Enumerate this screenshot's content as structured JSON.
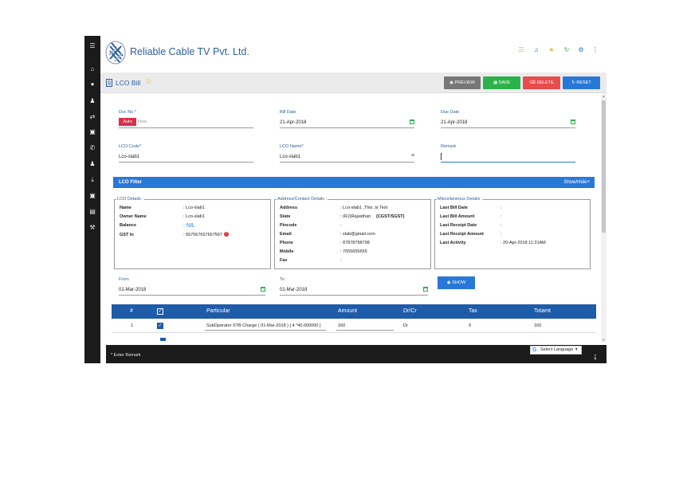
{
  "company": {
    "name": "Reliable Cable TV Pvt. Ltd."
  },
  "colors": {
    "primary": "#2878d8",
    "accent_text": "#2d5f9e",
    "save": "#2bb34a",
    "delete": "#e84c4c",
    "preview": "#777777",
    "sidebar": "#1b1b1b",
    "table_header": "#1e5ba8"
  },
  "sidebar": {
    "icons": [
      "menu-icon",
      "home-icon",
      "globe-icon",
      "user-icon",
      "transfer-icon",
      "book-icon",
      "phone-icon",
      "users-icon",
      "download-icon",
      "box-icon",
      "report-icon",
      "wrench-icon"
    ]
  },
  "header": {
    "icons": [
      "list-icon",
      "bell-icon",
      "star-icon",
      "refresh-icon",
      "gear-icon",
      "more-vertical-icon"
    ]
  },
  "page": {
    "title": "LCO Bill"
  },
  "toolbar": {
    "preview_label": "PREVIEW",
    "save_label": "SAVE",
    "delete_label": "DELETE",
    "reset_label": "RESET"
  },
  "form": {
    "doc_no": {
      "label": "Doc No.*",
      "badge": "Auto",
      "placeholder": "New"
    },
    "bill_date": {
      "label": "Bill Date",
      "value": "21-Apr-2018"
    },
    "due_date": {
      "label": "Due Date",
      "value": "21-Apr-2018"
    },
    "lco_code": {
      "label": "LCO Code*",
      "value": "Lco-slab1"
    },
    "lco_name": {
      "label": "LCO Name*",
      "value": "Lco-slab1"
    },
    "remark": {
      "label": "Remark",
      "value": ""
    }
  },
  "filter": {
    "title": "LCO Filter",
    "toggle": "Show/Hide"
  },
  "lco_details": {
    "legend": "LCO Details :",
    "name": {
      "k": "Name",
      "v": ": Lco-slab1"
    },
    "owner": {
      "k": "Owner Name",
      "v": ": Lco-slab1"
    },
    "balance": {
      "k": "Balance",
      "v": ": NIL"
    },
    "gst": {
      "k": "GST In",
      "v": ": 657567657657567"
    }
  },
  "address_details": {
    "legend": "Address/Contact Details :",
    "address": {
      "k": "Address",
      "v": ": Lco-slab1 ,This ,Is Test"
    },
    "state": {
      "k": "State",
      "v": ": (RJ)Rajasthan",
      "tax": "(CGST/SGST)"
    },
    "pincode": {
      "k": "Pincode",
      "v": ":"
    },
    "email": {
      "k": "Email",
      "v": ": slab@gmail.com"
    },
    "phone": {
      "k": "Phone",
      "v": ": 87878798798"
    },
    "mobile": {
      "k": "Mobile",
      "v": ": 7655655655"
    },
    "fax": {
      "k": "Fax",
      "v": ":"
    }
  },
  "misc_details": {
    "legend": "Miscellaneous Details :",
    "last_bill_date": {
      "k": "Last Bill Date",
      "v": ":"
    },
    "last_bill_amount": {
      "k": "Last Bill Amount",
      "v": ":"
    },
    "last_receipt_date": {
      "k": "Last Receipt Date",
      "v": ":"
    },
    "last_receipt_amount": {
      "k": "Last Receipt Amount",
      "v": ":"
    },
    "last_activity": {
      "k": "Last Activity",
      "v": ": 20-Apr-2018 11:31AM"
    }
  },
  "range": {
    "from": {
      "label": "From",
      "value": "01-Mar-2018"
    },
    "to": {
      "label": "To",
      "value": "01-Mar-2018"
    },
    "show_label": "SHOW"
  },
  "table": {
    "headers": {
      "no": "#",
      "particular": "Particular",
      "amount": "Amount",
      "drcr": "Dr/Cr",
      "tax": "Tax",
      "total": "Totamt"
    },
    "rows": [
      {
        "no": "1",
        "particular": "SubOperator STB Charge ( 01-Mar-2018 ) [ 4 *40.000000 ]",
        "amount": "160",
        "drcr": "Dr",
        "tax": "0",
        "total": "160"
      }
    ]
  },
  "footer": {
    "remark_note": "* Enter Remark",
    "language": "Select Language"
  }
}
